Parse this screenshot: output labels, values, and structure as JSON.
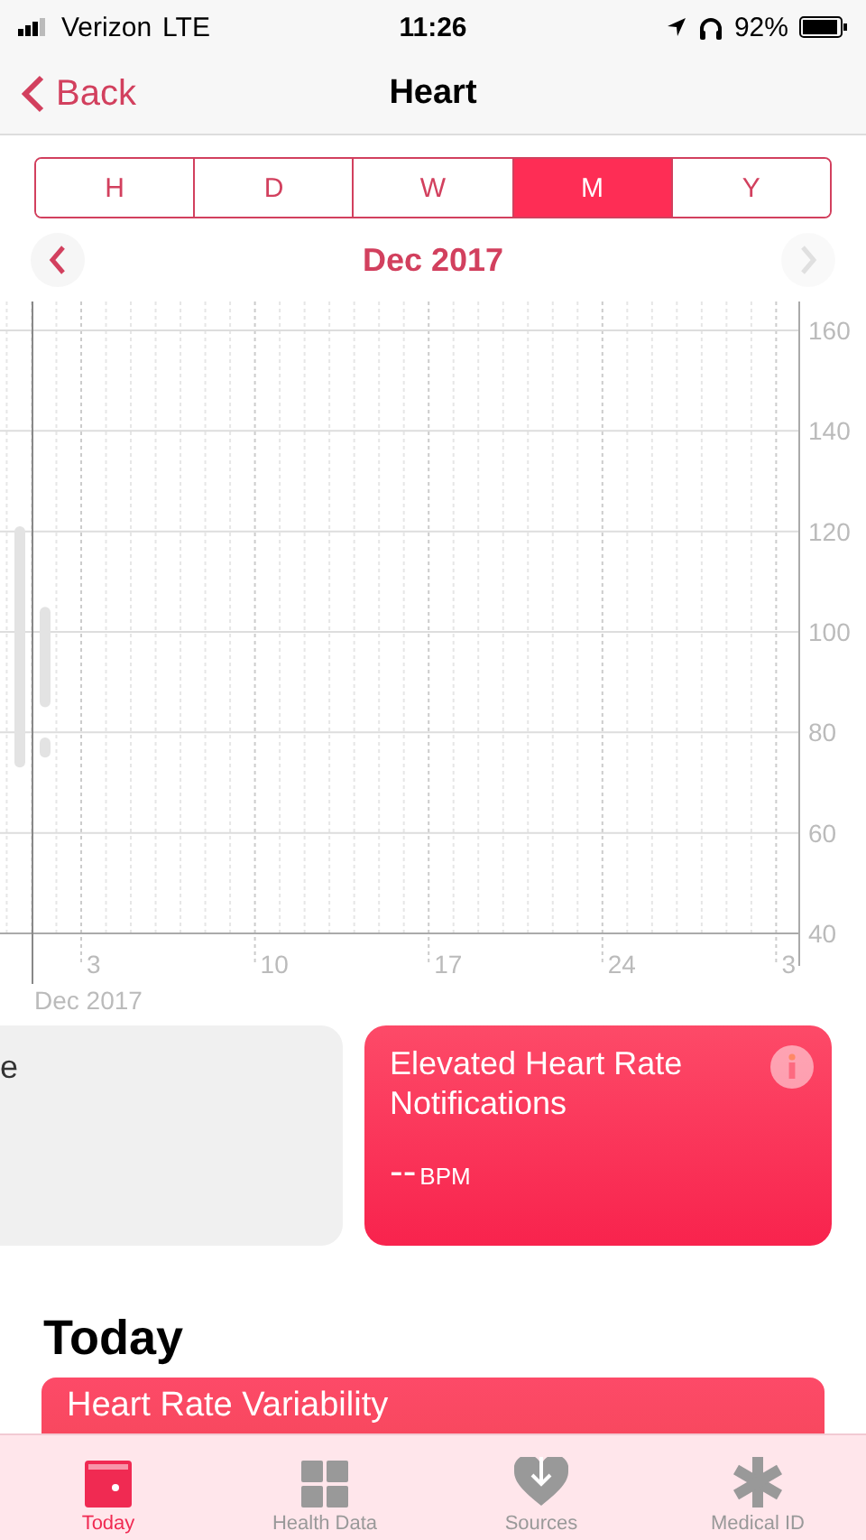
{
  "status_bar": {
    "carrier": "Verizon",
    "network": "LTE",
    "time": "11:26",
    "battery": "92%"
  },
  "nav": {
    "back": "Back",
    "title": "Heart"
  },
  "segments": [
    {
      "label": "H",
      "selected": false
    },
    {
      "label": "D",
      "selected": false
    },
    {
      "label": "W",
      "selected": false
    },
    {
      "label": "M",
      "selected": true
    },
    {
      "label": "Y",
      "selected": false
    }
  ],
  "period": {
    "label": "Dec 2017",
    "prev_enabled": true,
    "next_enabled": false
  },
  "chart": {
    "chart_data": {
      "type": "bar",
      "xlabel": "Dec 2017",
      "yticks": [
        40,
        60,
        80,
        100,
        120,
        140,
        160
      ],
      "ylim": [
        40,
        160
      ],
      "grid": true,
      "categories": [
        "3",
        "10",
        "17",
        "24",
        "3"
      ]
    }
  },
  "cards": [
    {
      "kind": "plain",
      "title": "e"
    },
    {
      "kind": "highlight",
      "title": "Elevated Heart Rate Notifications",
      "value": "--",
      "unit": "BPM"
    }
  ],
  "today": {
    "heading": "Today",
    "card": {
      "title": "Heart Rate Variability"
    }
  },
  "tabs": [
    {
      "label": "Today",
      "selected": true
    },
    {
      "label": "Health Data",
      "selected": false
    },
    {
      "label": "Sources",
      "selected": false
    },
    {
      "label": "Medical ID",
      "selected": false
    }
  ]
}
